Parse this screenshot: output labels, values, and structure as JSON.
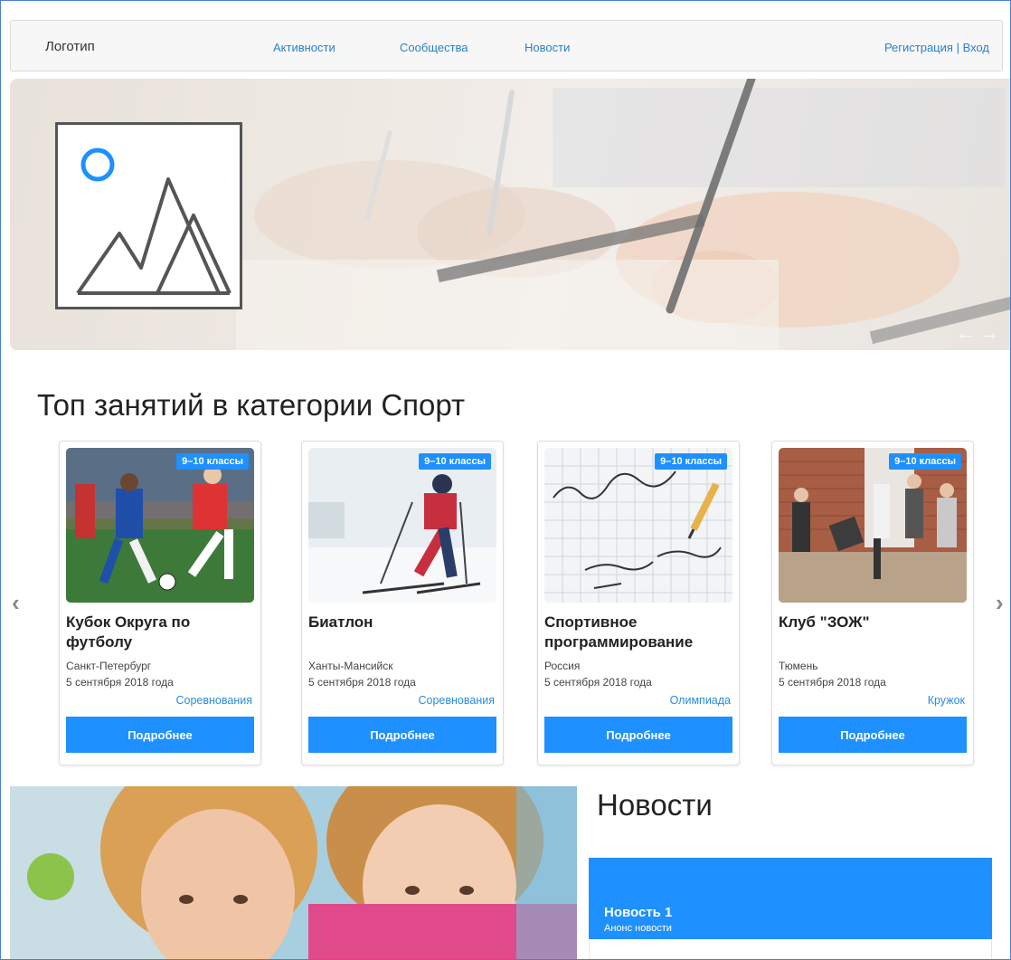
{
  "nav": {
    "logo": "Логотип",
    "links": [
      "Активности",
      "Сообщества",
      "Новости"
    ],
    "register": "Регистрация",
    "separator": "|",
    "login": "Вход"
  },
  "hero": {
    "arrows": [
      "←",
      "→"
    ]
  },
  "section": {
    "title": "Топ занятий в категории Спорт"
  },
  "carousel": {
    "prev": "‹",
    "next": "›"
  },
  "cards": [
    {
      "badge": "9–10 классы",
      "title": "Кубок Округа по футболу",
      "city": "Санкт-Петербург",
      "date": "5 сентября 2018 года",
      "type": "Соревнования",
      "button": "Подробнее"
    },
    {
      "badge": "9–10 классы",
      "title": "Биатлон",
      "city": "Ханты-Мансийск",
      "date": "5 сентября 2018 года",
      "type": "Соревнования",
      "button": "Подробнее"
    },
    {
      "badge": "9–10 классы",
      "title": "Спортивное программирование",
      "city": "Россия",
      "date": "5 сентября 2018 года",
      "type": "Олимпиада",
      "button": "Подробнее"
    },
    {
      "badge": "9–10 классы",
      "title": "Клуб \"ЗОЖ\"",
      "city": "Тюмень",
      "date": "5 сентября 2018 года",
      "type": "Кружок",
      "button": "Подробнее"
    }
  ],
  "news": {
    "title": "Новости",
    "items": [
      {
        "heading": "Новость 1",
        "summary": "Анонс новости"
      }
    ]
  },
  "colors": {
    "accent": "#1e90ff",
    "link": "#2a7fd0",
    "navbar_bg": "#f7f7f7"
  }
}
